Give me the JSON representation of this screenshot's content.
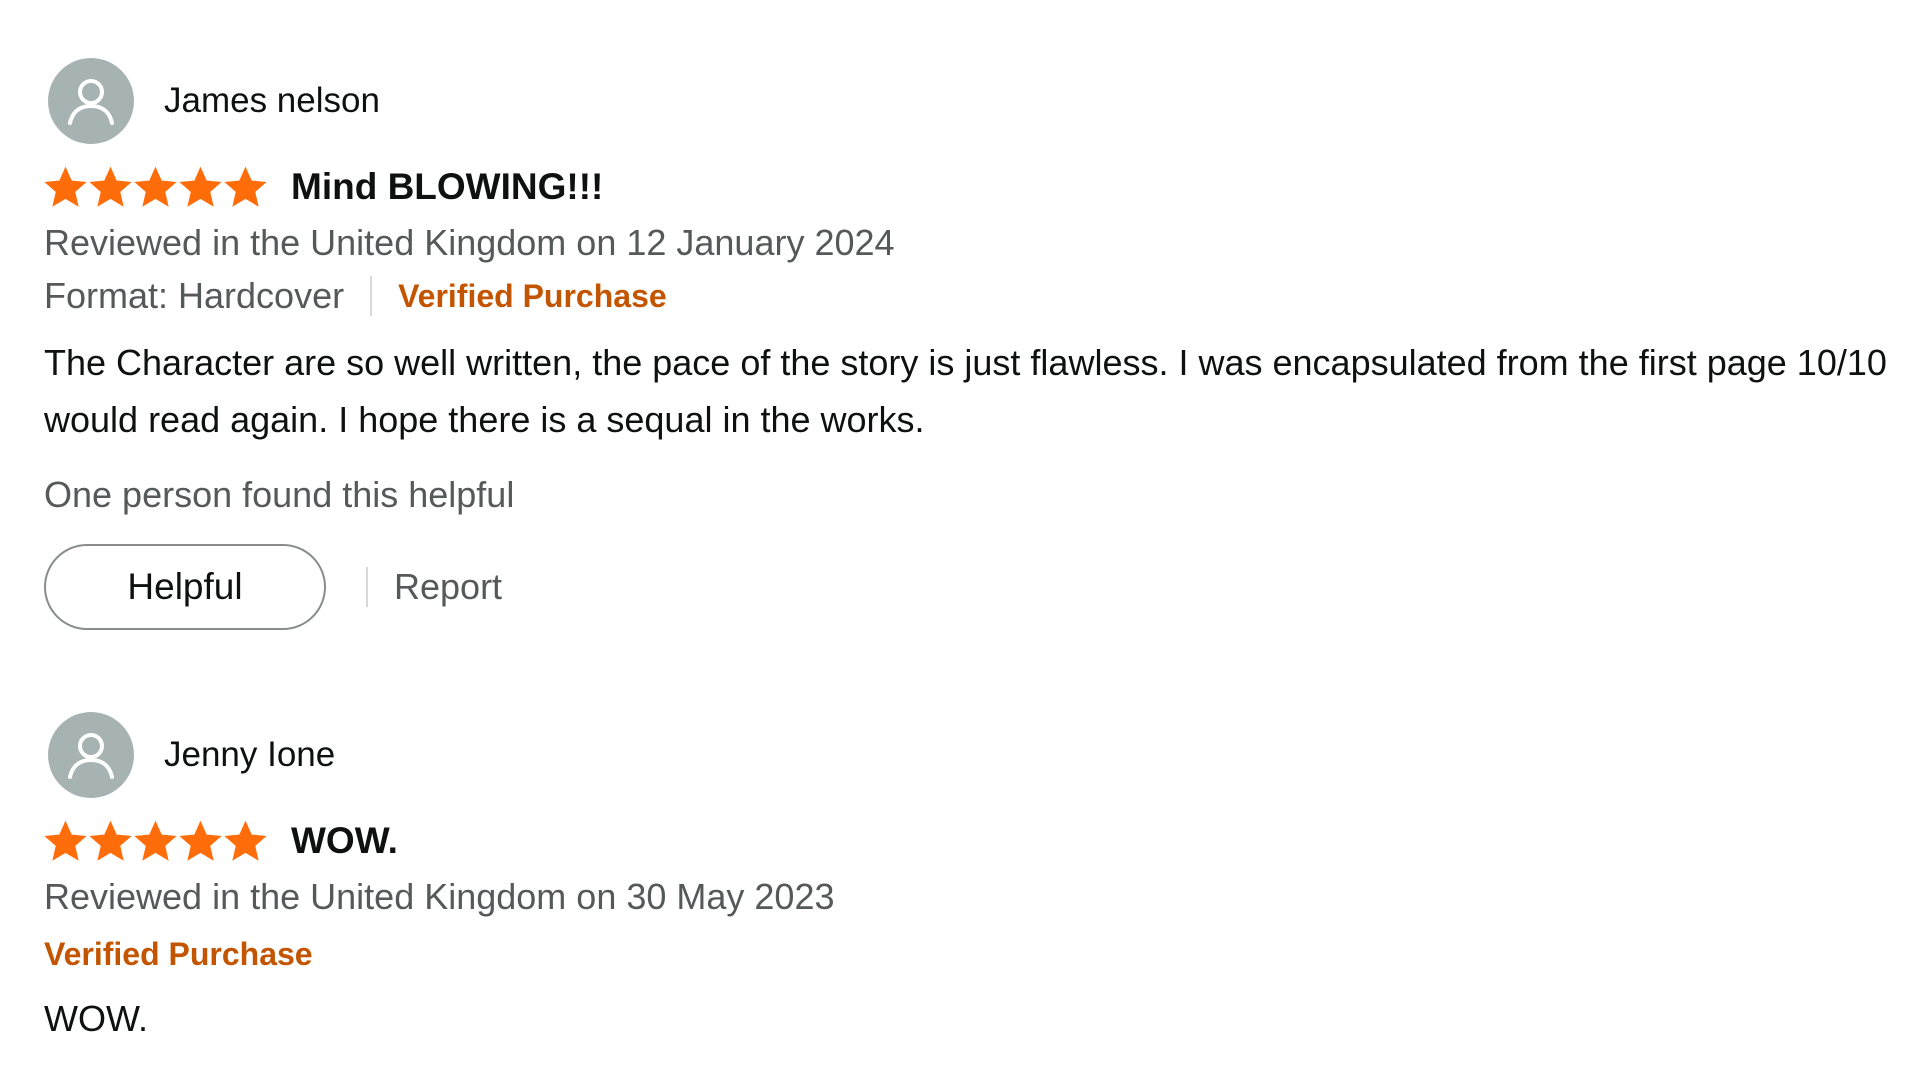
{
  "colors": {
    "star": "#ff6d0a",
    "verified": "#c45500",
    "secondary_text": "#565959",
    "primary_text": "#0f1111",
    "avatar_bg": "#a7b3b3"
  },
  "reviews": [
    {
      "profile_name": "James nelson",
      "avatar_icon": "user-avatar-icon",
      "rating": 5,
      "title": "Mind BLOWING!!!",
      "date": "Reviewed in the United Kingdom on 12 January 2024",
      "format": "Format: Hardcover",
      "verified": "Verified Purchase",
      "body": "The Character are so well written, the pace of the story is just flawless. I was encapsulated from the first page 10/10 would read again. I hope there is a sequal in the works.",
      "helpful_count": "One person found this helpful",
      "helpful_label": "Helpful",
      "report_label": "Report"
    },
    {
      "profile_name": "Jenny Ione",
      "avatar_icon": "user-avatar-icon",
      "rating": 5,
      "title": "WOW.",
      "date": "Reviewed in the United Kingdom on 30 May 2023",
      "verified": "Verified Purchase",
      "body": "WOW."
    }
  ]
}
